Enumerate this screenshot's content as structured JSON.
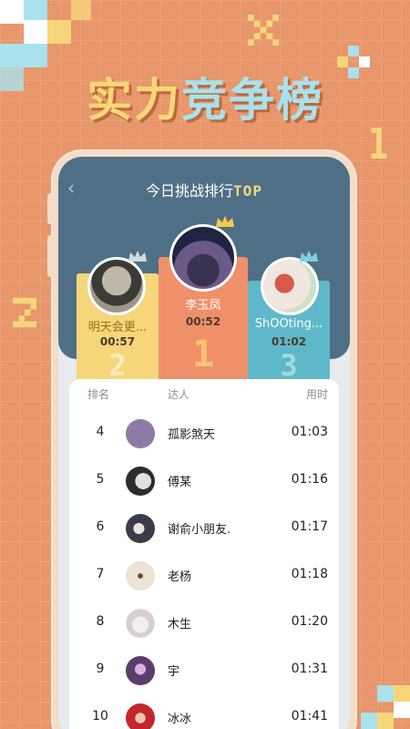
{
  "banner": {
    "part1": "实力",
    "part2": "竞争榜"
  },
  "screen": {
    "title": "今日挑战排行",
    "title_suffix": "TOP",
    "back_icon": "‹"
  },
  "podium": [
    {
      "rank": "2",
      "name": "明天会更...",
      "time": "00:57",
      "color": "#f6d67a",
      "name_color": "#9c6a1c"
    },
    {
      "rank": "1",
      "name": "李玉凤",
      "time": "00:52",
      "color": "#f0906a",
      "name_color": "#ffffff"
    },
    {
      "rank": "3",
      "name": "ShOOting...",
      "time": "01:02",
      "color": "#5fb8c9",
      "name_color": "#ffffff"
    }
  ],
  "list": {
    "headers": {
      "rank": "排名",
      "user": "达人",
      "time": "用时"
    },
    "rows": [
      {
        "rank": "4",
        "name": "孤影煞天",
        "time": "01:03",
        "avatar_color": "#8d7aa7"
      },
      {
        "rank": "5",
        "name": "傅某",
        "time": "01:16",
        "avatar_color": "#444444"
      },
      {
        "rank": "6",
        "name": "谢俞小朋友.",
        "time": "01:17",
        "avatar_color": "#3a3c4a"
      },
      {
        "rank": "7",
        "name": "老杨",
        "time": "01:18",
        "avatar_color": "#d9d2c2"
      },
      {
        "rank": "8",
        "name": "木生",
        "time": "01:20",
        "avatar_color": "#e9e4e6"
      },
      {
        "rank": "9",
        "name": "宇",
        "time": "01:31",
        "avatar_color": "#5a3d6e"
      },
      {
        "rank": "10",
        "name": "冰冰",
        "time": "01:41",
        "avatar_color": "#c1272d"
      }
    ]
  },
  "colors": {
    "background": "#e8966b",
    "screen_header": "#4f6f86",
    "gold": "#f6d67a",
    "cyan": "#a9e2ec"
  }
}
